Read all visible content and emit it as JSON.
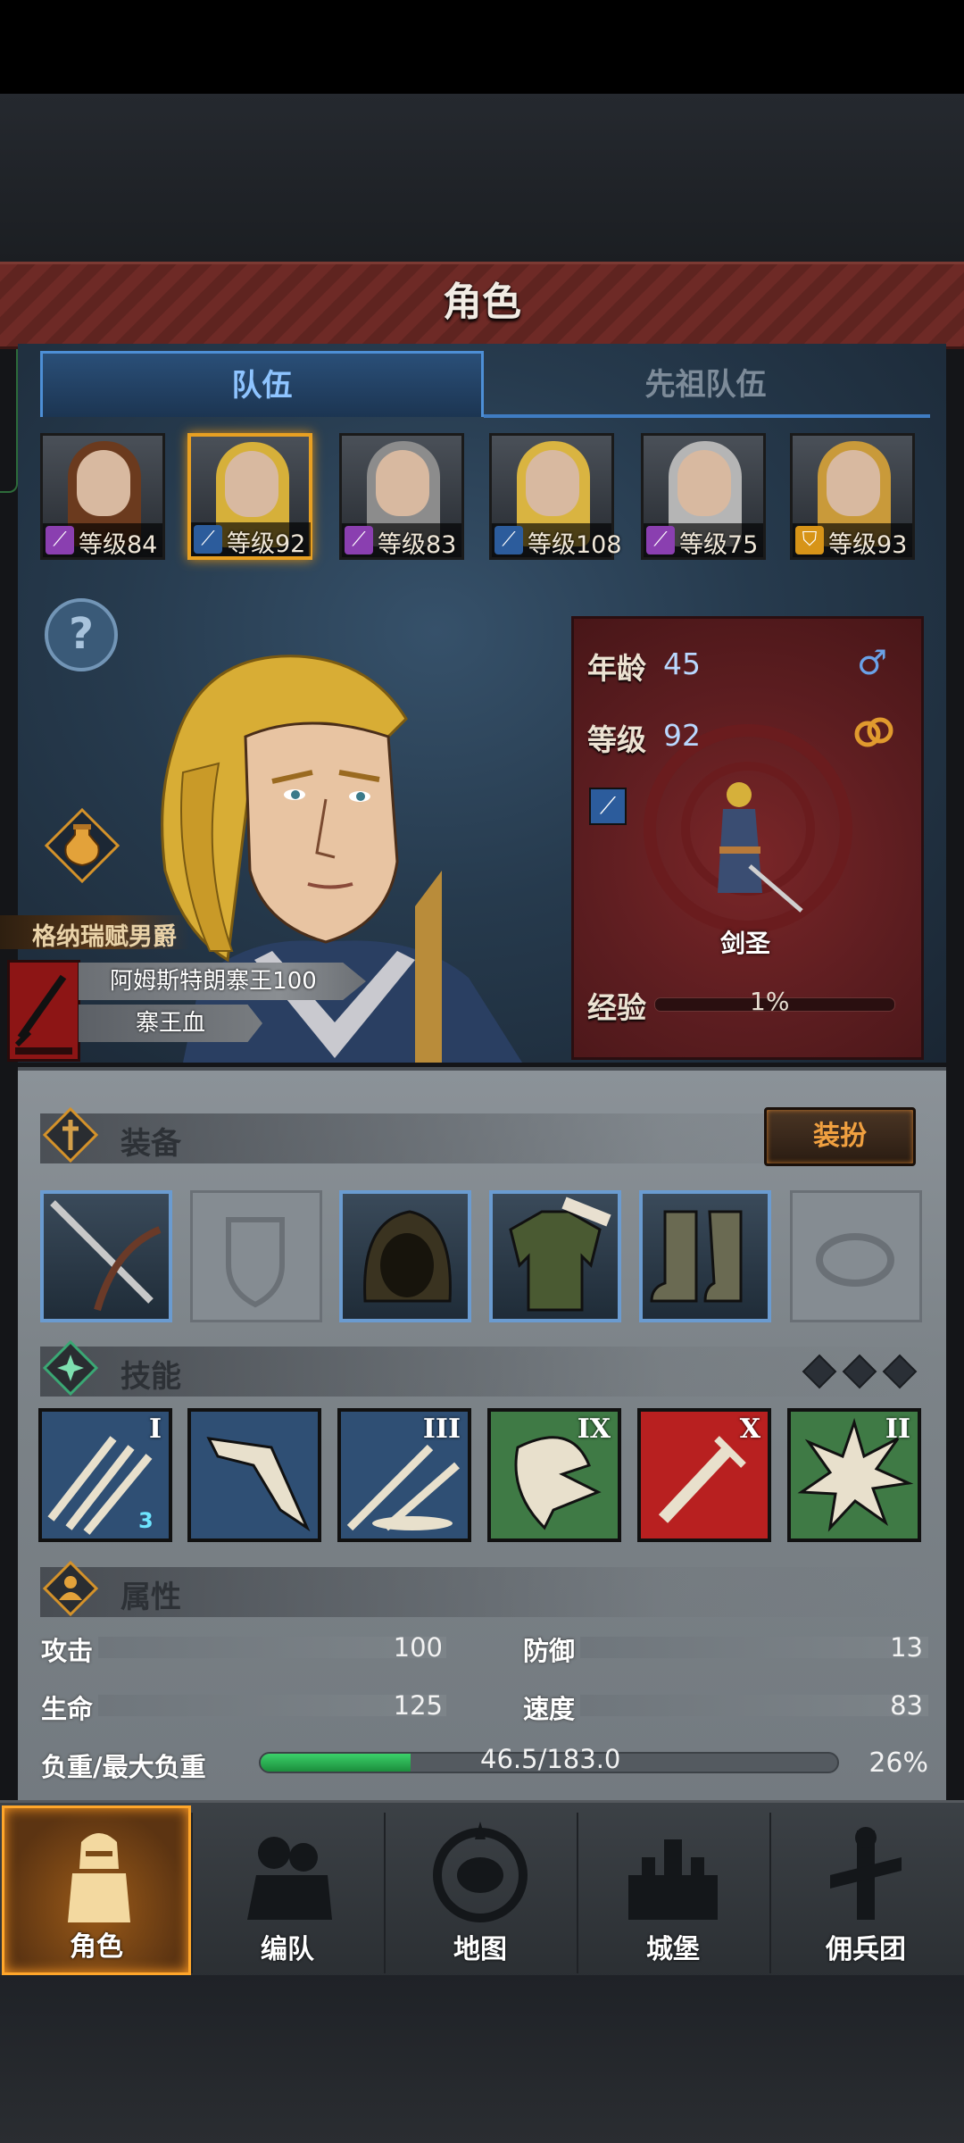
{
  "header": {
    "title": "角色"
  },
  "tabs": [
    {
      "label": "队伍"
    },
    {
      "label": "先祖队伍"
    }
  ],
  "team": [
    {
      "level_text": "等级84",
      "class_icon": "staff-icon",
      "badge_color": "#8a3fb0"
    },
    {
      "level_text": "等级92",
      "class_icon": "sword-icon",
      "badge_color": "#2c5c9c"
    },
    {
      "level_text": "等级83",
      "class_icon": "staff-icon",
      "badge_color": "#8a3fb0"
    },
    {
      "level_text": "等级108",
      "class_icon": "sword-icon",
      "badge_color": "#2c5c9c"
    },
    {
      "level_text": "等级75",
      "class_icon": "staff-icon",
      "badge_color": "#8a3fb0"
    },
    {
      "level_text": "等级93",
      "class_icon": "shield-icon",
      "badge_color": "#d79418"
    }
  ],
  "character": {
    "title": "格纳瑞赋男爵",
    "name": "阿姆斯特朗寨王100",
    "bloodline": "寨王血",
    "age_label": "年龄",
    "age": "45",
    "level_label": "等级",
    "level": "92",
    "class_name": "剑圣",
    "exp_label": "经验",
    "exp": "1%"
  },
  "equipment": {
    "section_label": "装备",
    "dress_button": "装扮",
    "slots": [
      {
        "name": "weapon-slot",
        "icon": "sword-bow-icon",
        "equipped": true
      },
      {
        "name": "shield-slot",
        "icon": "shield-icon",
        "equipped": false
      },
      {
        "name": "helmet-slot",
        "icon": "hood-icon",
        "equipped": true
      },
      {
        "name": "armor-slot",
        "icon": "tunic-icon",
        "equipped": true
      },
      {
        "name": "boots-slot",
        "icon": "boots-icon",
        "equipped": true
      },
      {
        "name": "ring-slot",
        "icon": "ring-icon",
        "equipped": false
      }
    ]
  },
  "skills": {
    "section_label": "技能",
    "items": [
      {
        "rank": "I",
        "color": "#2f4f74",
        "badge": "3"
      },
      {
        "rank": "",
        "color": "#2f4f74",
        "badge": ""
      },
      {
        "rank": "III",
        "color": "#2f4f74",
        "badge": ""
      },
      {
        "rank": "IX",
        "color": "#3f7a45",
        "badge": ""
      },
      {
        "rank": "X",
        "color": "#b82020",
        "badge": ""
      },
      {
        "rank": "II",
        "color": "#3f7a45",
        "badge": ""
      }
    ]
  },
  "attributes": {
    "section_label": "属性",
    "attack_label": "攻击",
    "attack": "100",
    "defense_label": "防御",
    "defense": "13",
    "hp_label": "生命",
    "hp": "125",
    "speed_label": "速度",
    "speed": "83",
    "load_label": "负重/最大负重",
    "load": "46.5/183.0",
    "load_percent": "26%",
    "load_fraction": 0.26
  },
  "nav": [
    {
      "label": "角色",
      "icon": "knight-icon",
      "active": true
    },
    {
      "label": "编队",
      "icon": "squad-icon",
      "active": false
    },
    {
      "label": "地图",
      "icon": "compass-icon",
      "active": false
    },
    {
      "label": "城堡",
      "icon": "castle-icon",
      "active": false
    },
    {
      "label": "佣兵团",
      "icon": "mercenary-icon",
      "active": false
    }
  ]
}
